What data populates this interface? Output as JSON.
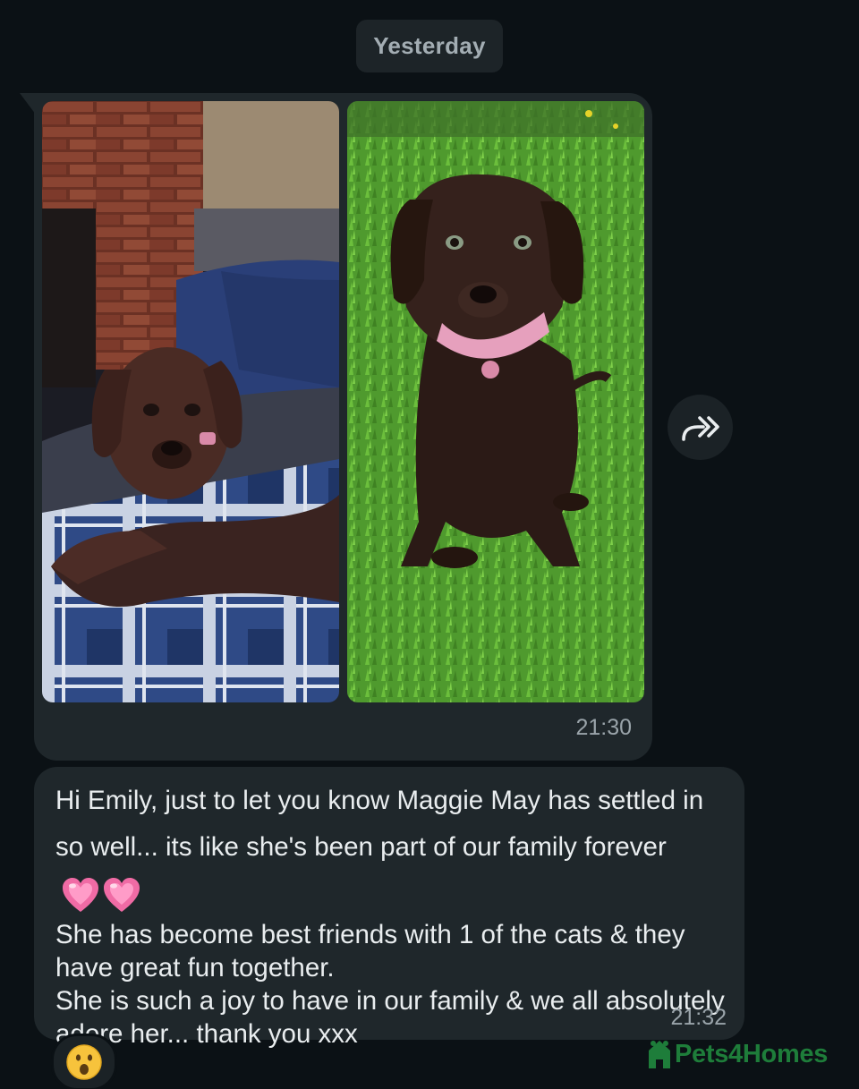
{
  "chat": {
    "date_separator": "Yesterday",
    "messages": [
      {
        "type": "images",
        "time": "21:30"
      },
      {
        "type": "text",
        "lines": [
          "Hi Emily, just to let you know Maggie May has settled in so well... its like she's been part of our family forever",
          "She has become best friends with 1 of the cats & they have great fun together.",
          "She is such a joy to have in our family & we all absolutely adore her... thank you xxx"
        ],
        "time": "21:32",
        "emoji": [
          "growing-heart",
          "growing-heart"
        ],
        "reaction": "astonished-face"
      }
    ],
    "forward_icon": "forward-icon"
  },
  "watermark": {
    "brand": "Pets4Homes",
    "color": "#1e7d3a"
  },
  "colors": {
    "background": "#0b1115",
    "bubble": "#1f272b",
    "text": "#e9edef",
    "timestamp": "#9aa4aa"
  }
}
